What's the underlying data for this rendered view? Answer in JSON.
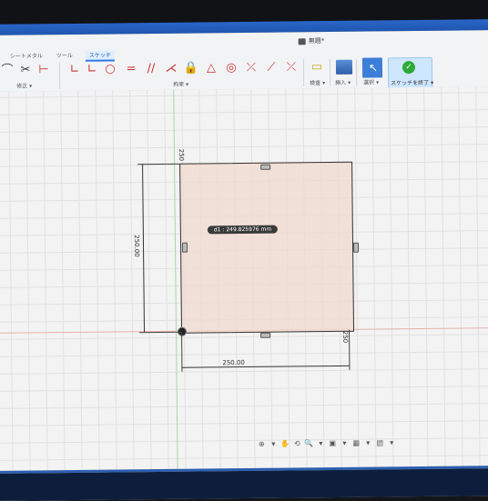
{
  "window": {
    "title": "無題*"
  },
  "tabs": [
    {
      "label": "シートメタル",
      "active": false
    },
    {
      "label": "ツール",
      "active": false
    },
    {
      "label": "スケッチ",
      "active": true
    }
  ],
  "ribbon": {
    "groups": [
      {
        "label": "修正 ▾"
      },
      {
        "label": "拘束 ▾"
      },
      {
        "label": "検査 ▾"
      },
      {
        "label": "挿入 ▾"
      },
      {
        "label": "選択 ▾"
      }
    ],
    "finish_label": "スケッチを終了 ▾",
    "tool_glyphs": {
      "arc": "⌒",
      "scissors": "✂",
      "measure": "⊢",
      "coincident": "∟",
      "circle": "○",
      "equal": "=",
      "parallel": "//",
      "perpendicular": "⋌",
      "lock": "🔒",
      "triangle": "△",
      "concentric": "◎",
      "tangent": "⤫",
      "symmetry": "⟋",
      "ruler": "▭",
      "check": "✓",
      "cursor": "↖"
    }
  },
  "sketch": {
    "dim_vertical_top": "250",
    "dim_vertical_left": "250.00",
    "dim_horizontal_bottom": "250.00",
    "dim_vertical_right": "250",
    "tooltip": "d1 : 249.825976 mm"
  },
  "navbar": {
    "glyphs": [
      "⊕",
      "▾",
      "✋",
      "⟲",
      "🔍",
      "▾",
      "▣",
      "▾",
      "▦",
      "▾",
      "▤",
      "▾"
    ]
  },
  "colors": {
    "title_bar": "#2a66c8",
    "sketch_fill": "#f0dace",
    "axis_red": "#e3b2a8",
    "axis_green": "#a8d6a8",
    "finish_green": "#2eaa3a",
    "accent": "#2d7be0"
  }
}
